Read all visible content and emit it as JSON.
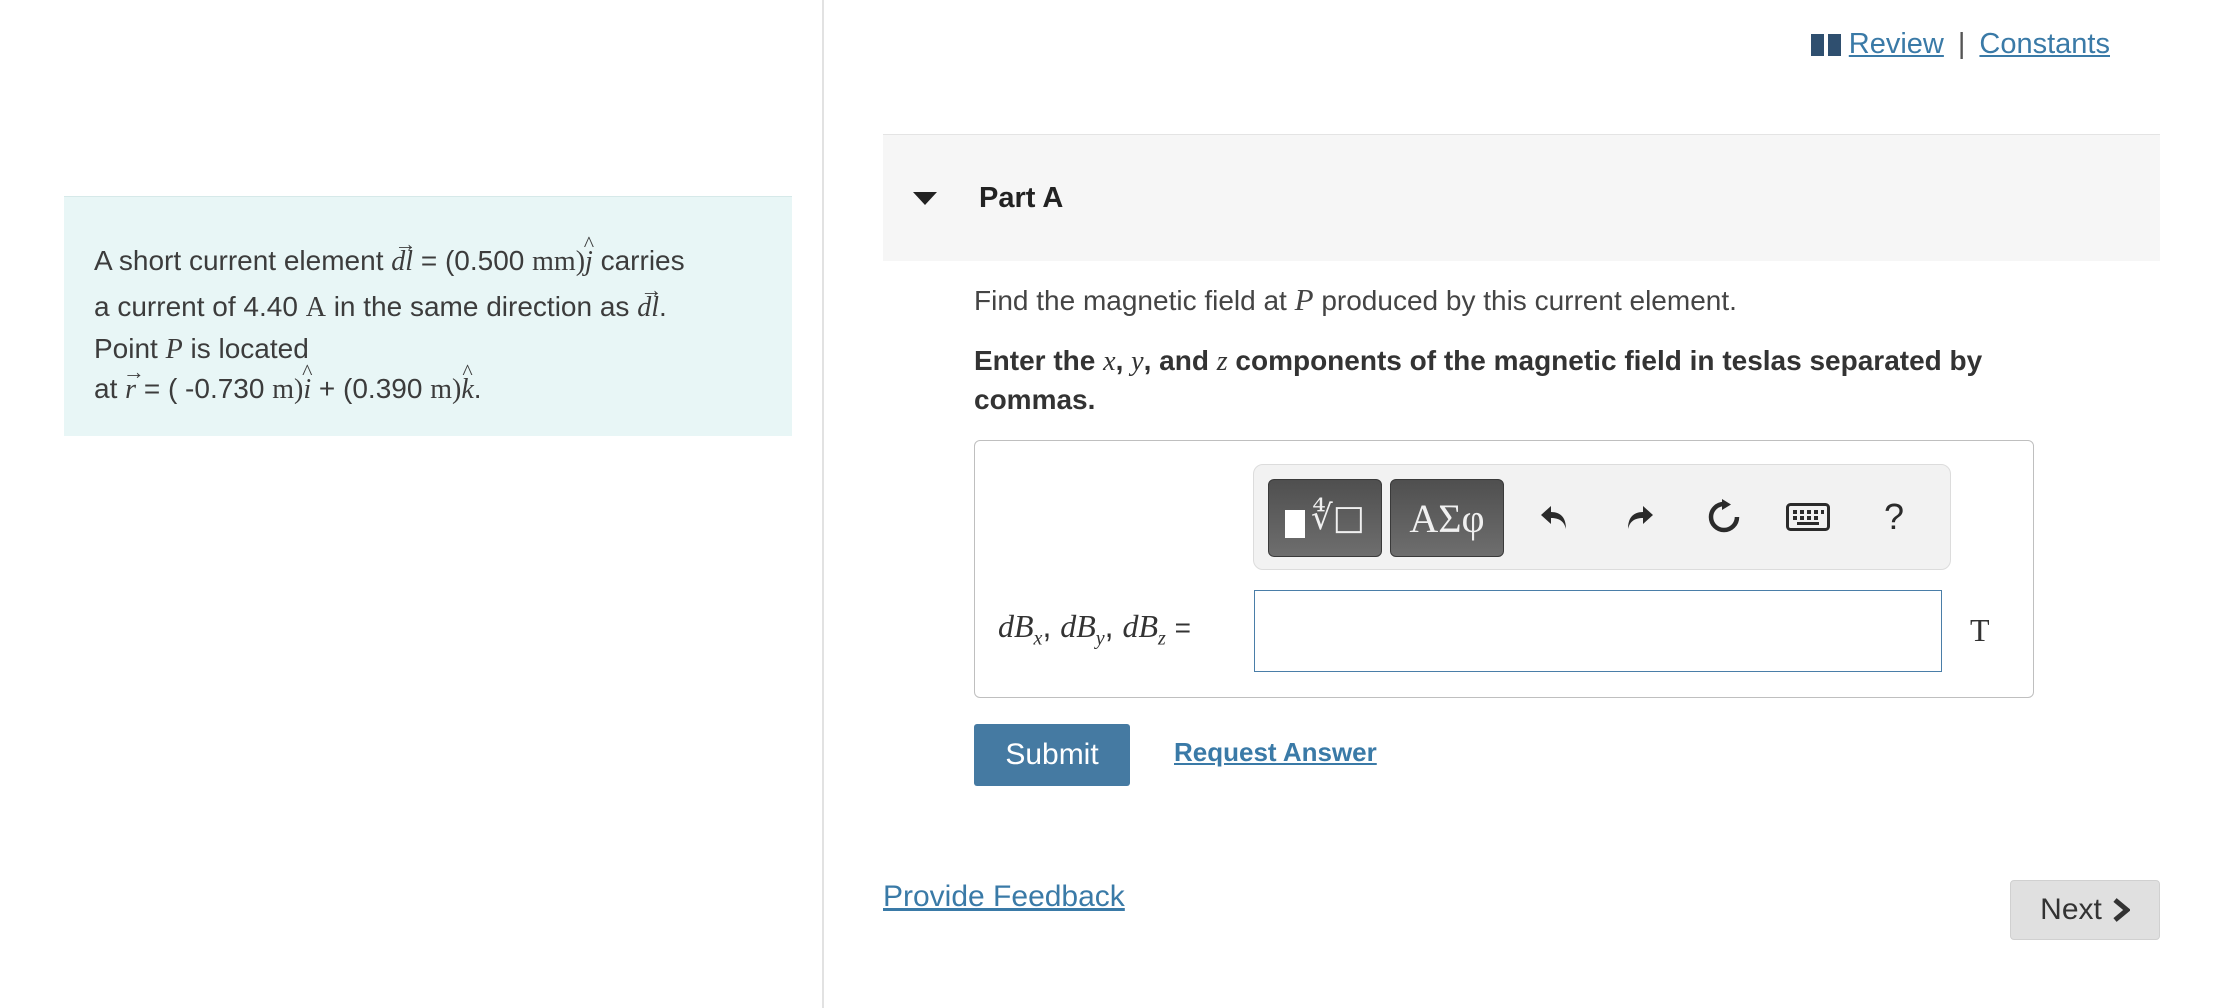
{
  "header": {
    "review_label": "Review",
    "separator": "|",
    "constants_label": "Constants",
    "book_icon": "book-icon"
  },
  "problem": {
    "line1_prefix": "A short current element ",
    "line1_eq": " = (0.500 ",
    "line1_unit": "mm",
    "line1_suffix": " carries",
    "line2_prefix": "a current of 4.40 ",
    "line2_unit": "A",
    "line2_mid": " in the same direction as ",
    "line2_end": ".",
    "line3_prefix": "Point ",
    "point_name": "P",
    "line3_suffix": " is located",
    "line4_prefix": "at ",
    "line4_eq1": " = ( -0.730 ",
    "line4_unit1": "m",
    "line4_plus": " + (0.390 ",
    "line4_unit2": "m",
    "line4_end": "."
  },
  "part": {
    "title": "Part A",
    "question_prefix": "Find the magnetic field at ",
    "question_var": "P",
    "question_suffix": " produced by this current element.",
    "instruction_1": "Enter the ",
    "instruction_x": "x",
    "instruction_2": ", ",
    "instruction_y": "y",
    "instruction_3": ", and ",
    "instruction_z": "z",
    "instruction_4": " components of the magnetic field in teslas separated by commas."
  },
  "toolbar": {
    "templates_icon": "templates-icon",
    "symbols_label": "ΑΣφ",
    "undo_icon": "undo-icon",
    "redo_icon": "redo-icon",
    "reset_icon": "reset-icon",
    "keyboard_icon": "keyboard-icon",
    "help_label": "?"
  },
  "answer": {
    "label_comma": ",",
    "label_eq": "=",
    "input_value": "",
    "unit": "T"
  },
  "actions": {
    "submit_label": "Submit",
    "request_answer_label": "Request Answer",
    "feedback_label": "Provide Feedback",
    "next_label": "Next",
    "next_icon": "chevron-right-icon"
  }
}
